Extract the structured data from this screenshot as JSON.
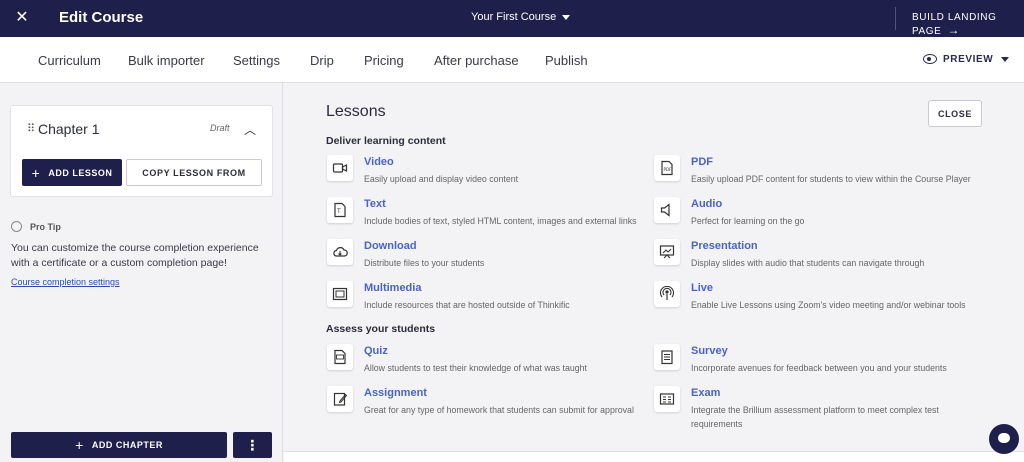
{
  "topbar": {
    "close_icon": "close-icon",
    "title": "Edit Course",
    "course_name": "Your First Course",
    "build_landing": "BUILD LANDING PAGE",
    "build_arrow": "→"
  },
  "nav": {
    "tabs": [
      "Curriculum",
      "Bulk importer",
      "Settings",
      "Drip",
      "Pricing",
      "After purchase",
      "Publish"
    ],
    "preview": "PREVIEW"
  },
  "sidebar": {
    "chapter_title": "Chapter 1",
    "chapter_status": "Draft",
    "add_lesson": "ADD LESSON",
    "copy_lesson": "COPY LESSON FROM",
    "protip_label": "Pro Tip",
    "protip_text": "You can customize the course completion experience with a certificate or a custom completion page!",
    "protip_link": "Course completion settings",
    "add_chapter": "ADD CHAPTER",
    "more": "⋮"
  },
  "main": {
    "title": "Lessons",
    "close": "CLOSE",
    "section_deliver": "Deliver learning content",
    "section_assess": "Assess your students",
    "deliver_items": [
      {
        "title": "Video",
        "desc": "Easily upload and display video content",
        "icon": "video-icon"
      },
      {
        "title": "PDF",
        "desc": "Easily upload PDF content for students to view within the Course Player",
        "icon": "pdf-icon"
      },
      {
        "title": "Text",
        "desc": "Include bodies of text, styled HTML content, images and external links",
        "icon": "text-icon"
      },
      {
        "title": "Audio",
        "desc": "Perfect for learning on the go",
        "icon": "audio-icon"
      },
      {
        "title": "Download",
        "desc": "Distribute files to your students",
        "icon": "download-icon"
      },
      {
        "title": "Presentation",
        "desc": "Display slides with audio that students can navigate through",
        "icon": "presentation-icon"
      },
      {
        "title": "Multimedia",
        "desc": "Include resources that are hosted outside of Thinkific",
        "icon": "multimedia-icon"
      },
      {
        "title": "Live",
        "desc": "Enable Live Lessons using Zoom's video meeting and/or webinar tools",
        "icon": "live-icon"
      }
    ],
    "assess_items": [
      {
        "title": "Quiz",
        "desc": "Allow students to test their knowledge of what was taught",
        "icon": "quiz-icon"
      },
      {
        "title": "Survey",
        "desc": "Incorporate avenues for feedback between you and your students",
        "icon": "survey-icon"
      },
      {
        "title": "Assignment",
        "desc": "Great for any type of homework that students can submit for approval",
        "icon": "assignment-icon"
      },
      {
        "title": "Exam",
        "desc": "Integrate the Brillium assessment platform to meet complex test requirements",
        "icon": "exam-icon"
      }
    ]
  }
}
